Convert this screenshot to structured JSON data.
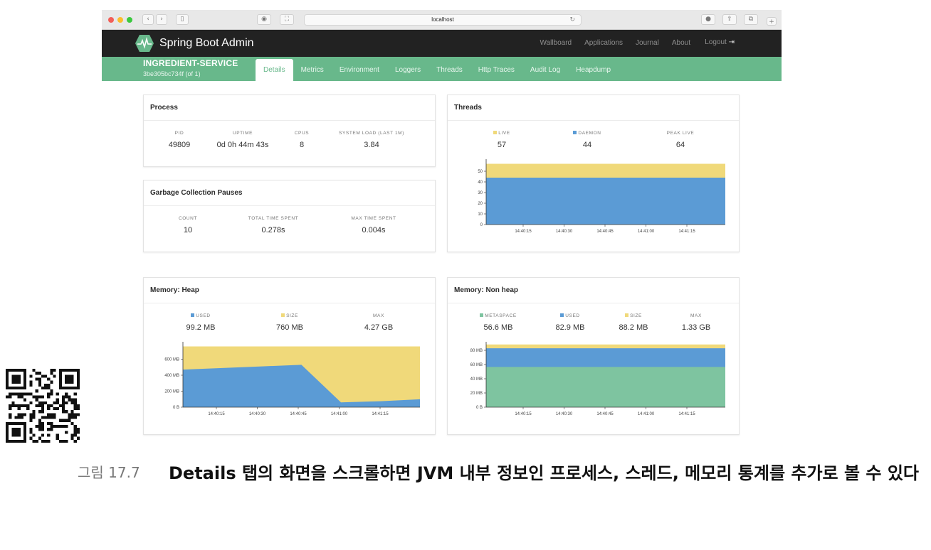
{
  "browser": {
    "url": "localhost"
  },
  "app": {
    "brand": "Spring Boot Admin",
    "nav": [
      "Wallboard",
      "Applications",
      "Journal",
      "About"
    ],
    "logout": "Logout",
    "instance_name": "INGREDIENT-SERVICE",
    "instance_id": "3be305bc734f (of 1)",
    "tabs": [
      "Details",
      "Metrics",
      "Environment",
      "Loggers",
      "Threads",
      "Http Traces",
      "Audit Log",
      "Heapdump"
    ],
    "active_tab": "Details"
  },
  "process": {
    "title": "Process",
    "stats": [
      {
        "label": "PID",
        "value": "49809"
      },
      {
        "label": "UPTIME",
        "value": "0d 0h 44m 43s"
      },
      {
        "label": "CPUS",
        "value": "8"
      },
      {
        "label": "SYSTEM LOAD (LAST 1M)",
        "value": "3.84"
      }
    ]
  },
  "gc": {
    "title": "Garbage Collection Pauses",
    "stats": [
      {
        "label": "COUNT",
        "value": "10"
      },
      {
        "label": "TOTAL TIME SPENT",
        "value": "0.278s"
      },
      {
        "label": "MAX TIME SPENT",
        "value": "0.004s"
      }
    ]
  },
  "threads": {
    "title": "Threads",
    "stats": [
      {
        "label": "LIVE",
        "value": "57",
        "color": "#f0d97a"
      },
      {
        "label": "DAEMON",
        "value": "44",
        "color": "#5b9bd5"
      },
      {
        "label": "PEAK LIVE",
        "value": "64"
      }
    ]
  },
  "heap": {
    "title": "Memory: Heap",
    "stats": [
      {
        "label": "USED",
        "value": "99.2 MB",
        "color": "#5b9bd5"
      },
      {
        "label": "SIZE",
        "value": "760 MB",
        "color": "#f0d97a"
      },
      {
        "label": "MAX",
        "value": "4.27 GB"
      }
    ]
  },
  "nonheap": {
    "title": "Memory: Non heap",
    "stats": [
      {
        "label": "METASPACE",
        "value": "56.6 MB",
        "color": "#7ec4a0"
      },
      {
        "label": "USED",
        "value": "82.9 MB",
        "color": "#5b9bd5"
      },
      {
        "label": "SIZE",
        "value": "88.2 MB",
        "color": "#f0d97a"
      },
      {
        "label": "MAX",
        "value": "1.33 GB"
      }
    ]
  },
  "chart_data": [
    {
      "type": "area",
      "name": "threads",
      "x": [
        "14:40:15",
        "14:40:30",
        "14:40:45",
        "14:41:00",
        "14:41:15"
      ],
      "y_ticks": [
        "0",
        "10",
        "20",
        "30",
        "40",
        "50"
      ],
      "ylim": [
        0,
        60
      ],
      "series": [
        {
          "name": "DAEMON",
          "values": [
            44,
            44,
            44,
            44,
            44,
            44
          ],
          "color": "#5b9bd5"
        },
        {
          "name": "LIVE",
          "values": [
            57,
            57,
            57,
            57,
            57,
            57
          ],
          "color": "#f0d97a"
        }
      ]
    },
    {
      "type": "area",
      "name": "heap",
      "x": [
        "14:40:15",
        "14:40:30",
        "14:40:45",
        "14:41:00",
        "14:41:15"
      ],
      "y_ticks": [
        "0 B",
        "200 MB",
        "400 MB",
        "600 MB"
      ],
      "ylim": [
        0,
        800
      ],
      "series": [
        {
          "name": "USED",
          "values": [
            470,
            490,
            510,
            530,
            60,
            75,
            99
          ],
          "color": "#5b9bd5"
        },
        {
          "name": "SIZE",
          "values": [
            760,
            760,
            760,
            760,
            760,
            760,
            760
          ],
          "color": "#f0d97a"
        }
      ]
    },
    {
      "type": "area",
      "name": "nonheap",
      "x": [
        "14:40:15",
        "14:40:30",
        "14:40:45",
        "14:41:00",
        "14:41:15"
      ],
      "y_ticks": [
        "0 B",
        "20 MB",
        "40 MB",
        "60 MB",
        "80 MB"
      ],
      "ylim": [
        0,
        90
      ],
      "series": [
        {
          "name": "METASPACE",
          "values": [
            56.6,
            56.6
          ],
          "color": "#7ec4a0"
        },
        {
          "name": "USED",
          "values": [
            82.9,
            82.9
          ],
          "color": "#5b9bd5"
        },
        {
          "name": "SIZE",
          "values": [
            88.2,
            88.2
          ],
          "color": "#f0d97a"
        }
      ]
    }
  ],
  "caption": {
    "number": "그림 17.7",
    "text": "Details 탭의 화면을 스크롤하면 JVM 내부 정보인 프로세스, 스레드, 메모리 통계를 추가로 볼 수 있다"
  }
}
